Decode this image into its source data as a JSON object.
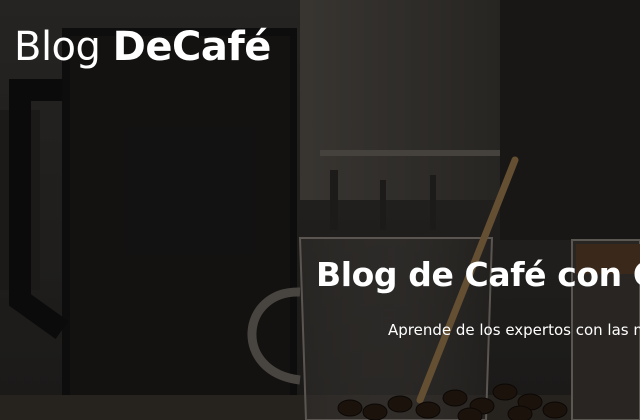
{
  "header": {
    "logo_regular": "Blog ",
    "logo_bold": "DeCafé"
  },
  "hero": {
    "title": "Blog de Café con Co",
    "subtitle": "Aprende de los expertos con las m"
  },
  "colors": {
    "text": "#ffffff",
    "overlay": "#1b1a19"
  }
}
